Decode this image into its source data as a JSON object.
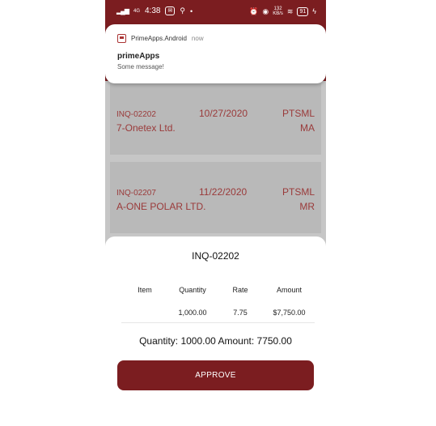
{
  "statusbar": {
    "network": "4G",
    "time": "4:38",
    "speed_value": "132",
    "speed_unit": "KB/s",
    "battery": "91"
  },
  "notification": {
    "app_name": "PrimeApps.Android",
    "time": "now",
    "title": "primeApps",
    "message": "Some message!"
  },
  "list": [
    {
      "inquiry": "INQ-02202",
      "date": "10/27/2020",
      "code": "PTSML",
      "customer": "7-Onetex Ltd.",
      "sub": "MA"
    },
    {
      "inquiry": "INQ-02207",
      "date": "11/22/2020",
      "code": "PTSML",
      "customer": "A-ONE POLAR LTD.",
      "sub": "MR"
    }
  ],
  "sheet": {
    "title": "INQ-02202",
    "headers": [
      "Item",
      "Quantity",
      "Rate",
      "Amount"
    ],
    "row": {
      "item": "",
      "quantity": "1,000.00",
      "rate": "7.75",
      "amount": "$7,750.00"
    },
    "totals_text": "Quantity:  1000.00  Amount: 7750.00",
    "approve_label": "APPROVE"
  },
  "colors": {
    "primary": "#7b1d20",
    "overlay": "#c6c6c6"
  }
}
